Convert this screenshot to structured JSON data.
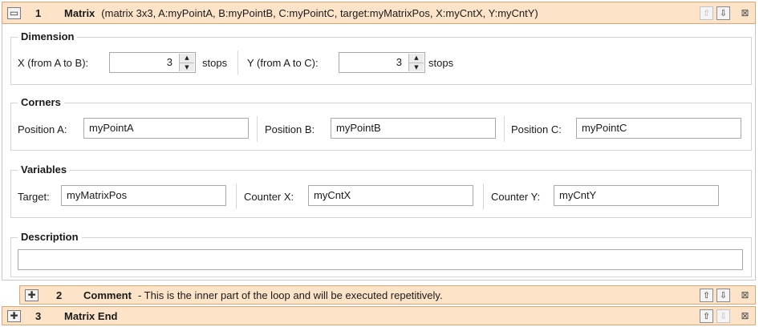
{
  "rows": [
    {
      "toggle_symbol": "▭",
      "number": "1",
      "name": "Matrix",
      "summary": "(matrix 3x3, A:myPointA, B:myPointB, C:myPointC, target:myMatrixPos, X:myCntX, Y:myCntY)",
      "up_icon": "⇧",
      "down_icon": "⇩",
      "close_icon": "⊠"
    },
    {
      "toggle_symbol": "✚",
      "number": "2",
      "name": "Comment",
      "summary": "- This is the inner part of the loop and will be executed repetitively.",
      "up_icon": "⇧",
      "down_icon": "⇩",
      "close_icon": "⊠"
    },
    {
      "toggle_symbol": "✚",
      "number": "3",
      "name": "Matrix End",
      "summary": "",
      "up_icon": "⇧",
      "down_icon": "⇩",
      "close_icon": "⊠"
    }
  ],
  "dimension": {
    "title": "Dimension",
    "x_label": "X (from A to B):",
    "x_value": "3",
    "x_unit": "stops",
    "y_label": "Y (from A to C):",
    "y_value": "3",
    "y_unit": "stops"
  },
  "corners": {
    "title": "Corners",
    "a_label": "Position A:",
    "a_value": "myPointA",
    "b_label": "Position B:",
    "b_value": "myPointB",
    "c_label": "Position C:",
    "c_value": "myPointC"
  },
  "variables": {
    "title": "Variables",
    "target_label": "Target:",
    "target_value": "myMatrixPos",
    "cx_label": "Counter X:",
    "cx_value": "myCntX",
    "cy_label": "Counter Y:",
    "cy_value": "myCntY"
  },
  "description": {
    "title": "Description",
    "value": ""
  },
  "colors": {
    "row_header_bg": "#fde3c8",
    "row_header_border": "#d9a777"
  },
  "spinner_icons": {
    "up": "▲",
    "down": "▼"
  }
}
